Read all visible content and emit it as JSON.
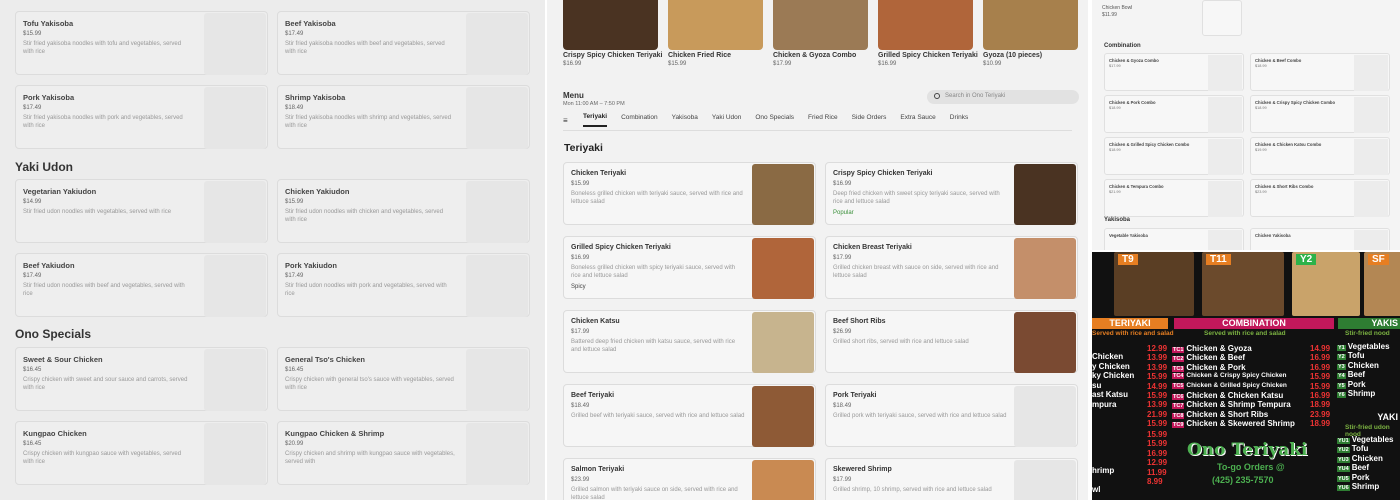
{
  "left": {
    "sections": [
      {
        "title": "",
        "cards": [
          {
            "name": "Tofu Yakisoba",
            "price": "$15.99",
            "desc": "Stir fried yakisoba noodles with tofu and vegetables, served with rice"
          },
          {
            "name": "Beef Yakisoba",
            "price": "$17.49",
            "desc": "Stir fried yakisoba noodles with beef and vegetables, served with rice"
          },
          {
            "name": "Pork Yakisoba",
            "price": "$17.49",
            "desc": "Stir fried yakisoba noodles with pork and vegetables, served with rice"
          },
          {
            "name": "Shrimp Yakisoba",
            "price": "$18.49",
            "desc": "Stir fried yakisoba noodles with shrimp and vegetables, served with rice"
          }
        ]
      },
      {
        "title": "Yaki Udon",
        "cards": [
          {
            "name": "Vegetarian Yakiudon",
            "price": "$14.99",
            "desc": "Stir fried udon noodles with vegetables, served with rice"
          },
          {
            "name": "Chicken Yakiudon",
            "price": "$15.99",
            "desc": "Stir fried udon noodles with chicken and vegetables, served with rice"
          },
          {
            "name": "Beef Yakiudon",
            "price": "$17.49",
            "desc": "Stir fried udon noodles with beef and vegetables, served with rice"
          },
          {
            "name": "Pork Yakiudon",
            "price": "$17.49",
            "desc": "Stir fried udon noodles with pork and vegetables, served with rice"
          }
        ]
      },
      {
        "title": "Ono Specials",
        "cards": [
          {
            "name": "Sweet & Sour Chicken",
            "price": "$16.45",
            "desc": "Crispy chicken with sweet and sour sauce and carrots, served with rice"
          },
          {
            "name": "General Tso's Chicken",
            "price": "$16.45",
            "desc": "Crispy chicken with general tso's sauce with vegetables, served with rice"
          },
          {
            "name": "Kungpao Chicken",
            "price": "$16.45",
            "desc": "Crispy chicken with kungpao sauce with vegetables, served with rice"
          },
          {
            "name": "Kungpao Chicken & Shrimp",
            "price": "$20.99",
            "desc": "Crispy chicken and shrimp with kungpao sauce with vegetables, served with"
          }
        ]
      }
    ]
  },
  "mid": {
    "top_items": [
      {
        "name": "Crispy Spicy Chicken Teriyaki",
        "price": "$16.99",
        "color": "#4a3322"
      },
      {
        "name": "Chicken Fried Rice",
        "price": "$15.99",
        "color": "#c89a5b"
      },
      {
        "name": "Chicken & Gyoza Combo",
        "price": "$17.99",
        "color": "#9b7a55"
      },
      {
        "name": "Grilled Spicy Chicken Teriyaki",
        "price": "$16.99",
        "color": "#b0653a"
      },
      {
        "name": "Gyoza (10 pieces)",
        "price": "$10.99",
        "color": "#a7804c"
      }
    ],
    "menu_label": "Menu",
    "hours": "Mon 11:00 AM – 7:50 PM",
    "search_placeholder": "Search in Ono Teriyaki",
    "list_icon": "≡",
    "tabs": [
      "Teriyaki",
      "Combination",
      "Yakisoba",
      "Yaki Udon",
      "Ono Specials",
      "Fried Rice",
      "Side Orders",
      "Extra Sauce",
      "Drinks"
    ],
    "section": "Teriyaki",
    "cards": [
      {
        "name": "Chicken Teriyaki",
        "price": "$15.99",
        "desc": "Boneless grilled chicken with teriyaki sauce, served with rice and lettuce salad",
        "badge": "",
        "color": "#8a6a44"
      },
      {
        "name": "Crispy Spicy Chicken Teriyaki",
        "price": "$16.99",
        "desc": "Deep fried chicken with sweet spicy teriyaki sauce, served with rice and lettuce salad",
        "badge": "Popular",
        "color": "#4a3322"
      },
      {
        "name": "Grilled Spicy Chicken Teriyaki",
        "price": "$16.99",
        "desc": "Boneless grilled chicken with spicy teriyaki sauce, served with rice and lettuce salad",
        "badge": "Spicy",
        "color": "#b0653a"
      },
      {
        "name": "Chicken Breast Teriyaki",
        "price": "$17.99",
        "desc": "Grilled chicken breast with sauce on side, served with rice and lettuce salad",
        "badge": "",
        "color": "#c48f6a"
      },
      {
        "name": "Chicken Katsu",
        "price": "$17.99",
        "desc": "Battered deep fried chicken with katsu sauce, served with rice and lettuce salad",
        "badge": "",
        "color": "#c7b48e"
      },
      {
        "name": "Beef Short Ribs",
        "price": "$26.99",
        "desc": "Grilled short ribs, served with rice and lettuce salad",
        "badge": "",
        "color": "#7a4a32"
      },
      {
        "name": "Beef Teriyaki",
        "price": "$18.49",
        "desc": "Grilled beef with teriyaki sauce, served with rice and lettuce salad",
        "badge": "",
        "color": "#8e5a36"
      },
      {
        "name": "Pork Teriyaki",
        "price": "$18.49",
        "desc": "Grilled pork with teriyaki sauce, served with rice and lettuce salad",
        "badge": "",
        "color": "#e6e6e6"
      },
      {
        "name": "Salmon Teriyaki",
        "price": "$23.99",
        "desc": "Grilled salmon with teriyaki sauce on side, served with rice and lettuce salad",
        "badge": "",
        "color": "#c98a52"
      },
      {
        "name": "Skewered Shrimp",
        "price": "$17.99",
        "desc": "Grilled shrimp, 10 shrimp, served with rice and lettuce salad",
        "badge": "",
        "color": "#e6e6e6"
      }
    ]
  },
  "rtop": {
    "top_line1": "Chicken Bowl",
    "top_line2": "$11.99",
    "combination": "Combination",
    "yakisoba": "Yakisoba",
    "cards": [
      {
        "name": "Chicken & Gyoza Combo",
        "price": "$17.99"
      },
      {
        "name": "Chicken & Beef Combo",
        "price": "$18.99"
      },
      {
        "name": "Chicken & Pork Combo",
        "price": "$18.99"
      },
      {
        "name": "Chicken & Crispy Spicy Chicken Combo",
        "price": "$18.99"
      },
      {
        "name": "Chicken & Grilled Spicy Chicken Combo",
        "price": "$18.99"
      },
      {
        "name": "Chicken & Chicken Katsu Combo",
        "price": "$19.99"
      },
      {
        "name": "Chicken & Tempura Combo",
        "price": "$21.99"
      },
      {
        "name": "Chicken & Short Ribs Combo",
        "price": "$23.99"
      },
      {
        "name": "Vegetable Yakisoba",
        "price": ""
      },
      {
        "name": "Chicken Yakisoba",
        "price": ""
      }
    ]
  },
  "sign": {
    "codes": [
      "T9",
      "T11",
      "Y2",
      "SF"
    ],
    "teriyaki": "TERIYAKI",
    "teriyaki_sub": "Served with rice and salad",
    "combination": "COMBINATION",
    "combination_sub": "Served with rice and salad",
    "yakisoba": "YAKIS",
    "yakisoba_sub": "Stir-fried nood",
    "left_items": [
      "Chicken",
      "y Chicken",
      "ky Chicken",
      "su",
      "ast Katsu",
      "mpura",
      "",
      "",
      "",
      "",
      "",
      "",
      "hrimp",
      "",
      "wl"
    ],
    "combo": [
      {
        "code": "TC1",
        "name": "Chicken & Gyoza",
        "lp": "12.99",
        "rp": "14.99"
      },
      {
        "code": "TC2",
        "name": "Chicken & Beef",
        "lp": "13.99",
        "rp": "16.99"
      },
      {
        "code": "TC3",
        "name": "Chicken & Pork",
        "lp": "13.99",
        "rp": "16.99"
      },
      {
        "code": "TC4",
        "name": "Chicken & Crispy Spicy Chicken",
        "lp": "15.99",
        "rp": "15.99"
      },
      {
        "code": "TC5",
        "name": "Chicken & Grilled Spicy Chicken",
        "lp": "14.99",
        "rp": "15.99"
      },
      {
        "code": "TC6",
        "name": "Chicken & Chicken Katsu",
        "lp": "15.99",
        "rp": "16.99"
      },
      {
        "code": "TC7",
        "name": "Chicken & Shrimp Tempura",
        "lp": "13.99",
        "rp": "18.99"
      },
      {
        "code": "TC8",
        "name": "Chicken & Short Ribs",
        "lp": "21.99",
        "rp": "23.99"
      },
      {
        "code": "TC9",
        "name": "Chicken & Skewered Shrimp",
        "lp": "15.99",
        "rp": "18.99"
      }
    ],
    "yaki_list": [
      {
        "code": "Y1",
        "name": "Vegetables"
      },
      {
        "code": "Y2",
        "name": "Tofu"
      },
      {
        "code": "Y3",
        "name": "Chicken"
      },
      {
        "code": "Y4",
        "name": "Beef"
      },
      {
        "code": "Y5",
        "name": "Pork"
      },
      {
        "code": "Y6",
        "name": "Shrimp"
      }
    ],
    "udon_head": "YAKI",
    "udon_sub": "Stir-fried udon nood",
    "udon_list": [
      {
        "code": "YU1",
        "name": "Vegetables"
      },
      {
        "code": "YU2",
        "name": "Tofu"
      },
      {
        "code": "YU3",
        "name": "Chicken"
      },
      {
        "code": "YU4",
        "name": "Beef"
      },
      {
        "code": "YU5",
        "name": "Pork"
      },
      {
        "code": "YU6",
        "name": "Shrimp"
      }
    ],
    "extra_prices": [
      "15.99",
      "15.99",
      "16.99",
      "12.99",
      "11.99",
      "8.99"
    ],
    "logo": "Ono Teriyaki",
    "togo": "To-go Orders @",
    "phone": "(425) 235-7570"
  }
}
